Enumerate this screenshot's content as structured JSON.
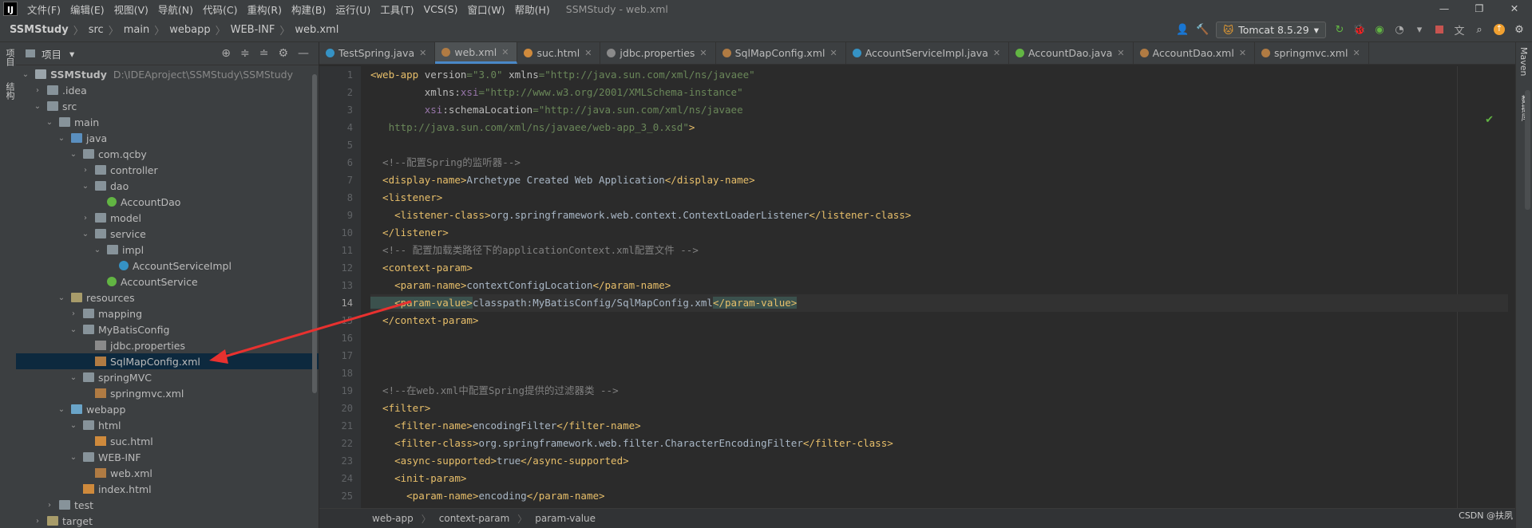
{
  "menubar": {
    "logo": "IJ",
    "items": [
      "文件(F)",
      "编辑(E)",
      "视图(V)",
      "导航(N)",
      "代码(C)",
      "重构(R)",
      "构建(B)",
      "运行(U)",
      "工具(T)",
      "VCS(S)",
      "窗口(W)",
      "帮助(H)"
    ],
    "title": "SSMStudy - web.xml",
    "win_controls": [
      "—",
      "❐",
      "✕"
    ]
  },
  "nav": {
    "breadcrumb": [
      "SSMStudy",
      "src",
      "main",
      "webapp",
      "WEB-INF",
      "web.xml"
    ],
    "run_config": "Tomcat 8.5.29"
  },
  "left_stripe": {
    "project_label": "项目",
    "structure_label": "结构"
  },
  "project_panel": {
    "title": "项目",
    "tree": [
      {
        "label": "SSMStudy",
        "path": "D:\\IDEAproject\\SSMStudy\\SSMStudy",
        "depth": 0,
        "arrow": "open",
        "icon": "root",
        "bold": true
      },
      {
        "label": ".idea",
        "depth": 1,
        "arrow": "closed",
        "icon": "folder"
      },
      {
        "label": "src",
        "depth": 1,
        "arrow": "open",
        "icon": "folder"
      },
      {
        "label": "main",
        "depth": 2,
        "arrow": "open",
        "icon": "folder"
      },
      {
        "label": "java",
        "depth": 3,
        "arrow": "open",
        "icon": "src"
      },
      {
        "label": "com.qcby",
        "depth": 4,
        "arrow": "open",
        "icon": "folder"
      },
      {
        "label": "controller",
        "depth": 5,
        "arrow": "closed",
        "icon": "folder"
      },
      {
        "label": "dao",
        "depth": 5,
        "arrow": "open",
        "icon": "folder"
      },
      {
        "label": "AccountDao",
        "depth": 6,
        "arrow": "none",
        "icon": "interface"
      },
      {
        "label": "model",
        "depth": 5,
        "arrow": "closed",
        "icon": "folder"
      },
      {
        "label": "service",
        "depth": 5,
        "arrow": "open",
        "icon": "folder"
      },
      {
        "label": "impl",
        "depth": 6,
        "arrow": "open",
        "icon": "folder"
      },
      {
        "label": "AccountServiceImpl",
        "depth": 7,
        "arrow": "none",
        "icon": "class"
      },
      {
        "label": "AccountService",
        "depth": 6,
        "arrow": "none",
        "icon": "interface"
      },
      {
        "label": "resources",
        "depth": 3,
        "arrow": "open",
        "icon": "res"
      },
      {
        "label": "mapping",
        "depth": 4,
        "arrow": "closed",
        "icon": "folder"
      },
      {
        "label": "MyBatisConfig",
        "depth": 4,
        "arrow": "open",
        "icon": "folder"
      },
      {
        "label": "jdbc.properties",
        "depth": 5,
        "arrow": "none",
        "icon": "prop"
      },
      {
        "label": "SqlMapConfig.xml",
        "depth": 5,
        "arrow": "none",
        "icon": "xml",
        "selected": true
      },
      {
        "label": "springMVC",
        "depth": 4,
        "arrow": "open",
        "icon": "folder"
      },
      {
        "label": "springmvc.xml",
        "depth": 5,
        "arrow": "none",
        "icon": "xml"
      },
      {
        "label": "webapp",
        "depth": 3,
        "arrow": "open",
        "icon": "blue"
      },
      {
        "label": "html",
        "depth": 4,
        "arrow": "open",
        "icon": "folder"
      },
      {
        "label": "suc.html",
        "depth": 5,
        "arrow": "none",
        "icon": "html"
      },
      {
        "label": "WEB-INF",
        "depth": 4,
        "arrow": "open",
        "icon": "folder"
      },
      {
        "label": "web.xml",
        "depth": 5,
        "arrow": "none",
        "icon": "xml"
      },
      {
        "label": "index.html",
        "depth": 4,
        "arrow": "none",
        "icon": "html"
      },
      {
        "label": "test",
        "depth": 2,
        "arrow": "closed",
        "icon": "folder"
      },
      {
        "label": "target",
        "depth": 1,
        "arrow": "closed",
        "icon": "res"
      }
    ]
  },
  "tabs": [
    {
      "label": "TestSpring.java",
      "icon": "#3592c4"
    },
    {
      "label": "web.xml",
      "icon": "#b07b43",
      "active": true
    },
    {
      "label": "suc.html",
      "icon": "#cf8a3c"
    },
    {
      "label": "jdbc.properties",
      "icon": "#8a8a8a"
    },
    {
      "label": "SqlMapConfig.xml",
      "icon": "#b07b43"
    },
    {
      "label": "AccountServiceImpl.java",
      "icon": "#3592c4"
    },
    {
      "label": "AccountDao.java",
      "icon": "#62b543"
    },
    {
      "label": "AccountDao.xml",
      "icon": "#b07b43"
    },
    {
      "label": "springmvc.xml",
      "icon": "#b07b43"
    }
  ],
  "editor": {
    "current_line": 14,
    "lines": [
      [
        [
          "t",
          "<web-app "
        ],
        [
          "a",
          "version"
        ],
        [
          "v",
          "=\"3.0\" "
        ],
        [
          "a",
          "xmlns"
        ],
        [
          "v",
          "=\"http://java.sun.com/xml/ns/javaee\""
        ]
      ],
      [
        [
          "a",
          "         xmlns:"
        ],
        [
          "ns",
          "xsi"
        ],
        [
          "v",
          "=\"http://www.w3.org/2001/XMLSchema-instance\""
        ]
      ],
      [
        [
          "ns",
          "         xsi"
        ],
        [
          "a",
          ":schemaLocation"
        ],
        [
          "v",
          "=\"http://java.sun.com/xml/ns/javaee"
        ]
      ],
      [
        [
          "v",
          "   http://java.sun.com/xml/ns/javaee/web-app_3_0.xsd\""
        ],
        [
          "t",
          ">"
        ]
      ],
      [
        [
          "tx",
          ""
        ]
      ],
      [
        [
          "cm",
          "  <!--配置Spring的监听器-->"
        ]
      ],
      [
        [
          "t",
          "  <display-name>"
        ],
        [
          "tx",
          "Archetype Created Web Application"
        ],
        [
          "t",
          "</display-name>"
        ]
      ],
      [
        [
          "t",
          "  <listener>"
        ]
      ],
      [
        [
          "t",
          "    <listener-class>"
        ],
        [
          "tx",
          "org.springframework.web.context.ContextLoaderListener"
        ],
        [
          "t",
          "</listener-class>"
        ]
      ],
      [
        [
          "t",
          "  </listener>"
        ]
      ],
      [
        [
          "cm",
          "  <!-- 配置加载类路径下的applicationContext.xml配置文件 -->"
        ]
      ],
      [
        [
          "t",
          "  <context-param>"
        ]
      ],
      [
        [
          "t",
          "    <param-name>"
        ],
        [
          "tx",
          "contextConfigLocation"
        ],
        [
          "t",
          "</param-name>"
        ]
      ],
      [
        [
          "t",
          "    <param-value>"
        ],
        [
          "tx",
          "classpath:MyBatisConfig/SqlMapConfig.xml"
        ],
        [
          "t",
          "</param-value>"
        ]
      ],
      [
        [
          "t",
          "  </context-param>"
        ]
      ],
      [
        [
          "tx",
          ""
        ]
      ],
      [
        [
          "tx",
          ""
        ]
      ],
      [
        [
          "tx",
          ""
        ]
      ],
      [
        [
          "cm",
          "  <!--在web.xml中配置Spring提供的过滤器类 -->"
        ]
      ],
      [
        [
          "t",
          "  <filter>"
        ]
      ],
      [
        [
          "t",
          "    <filter-name>"
        ],
        [
          "tx",
          "encodingFilter"
        ],
        [
          "t",
          "</filter-name>"
        ]
      ],
      [
        [
          "t",
          "    <filter-class>"
        ],
        [
          "tx",
          "org.springframework.web.filter.CharacterEncodingFilter"
        ],
        [
          "t",
          "</filter-class>"
        ]
      ],
      [
        [
          "t",
          "    <async-supported>"
        ],
        [
          "tx",
          "true"
        ],
        [
          "t",
          "</async-supported>"
        ]
      ],
      [
        [
          "t",
          "    <init-param>"
        ]
      ],
      [
        [
          "t",
          "      <param-name>"
        ],
        [
          "tx",
          "encoding"
        ],
        [
          "t",
          "</param-name>"
        ]
      ]
    ]
  },
  "editor_breadcrumb": [
    "web-app",
    "context-param",
    "param-value"
  ],
  "right_stripe": {
    "maven": "Maven",
    "database": "数据库"
  },
  "watermark": "CSDN @扶夙",
  "colors": {
    "accent": "#4a88c7",
    "selection": "#0d293e",
    "arrow": "#e8312f"
  }
}
